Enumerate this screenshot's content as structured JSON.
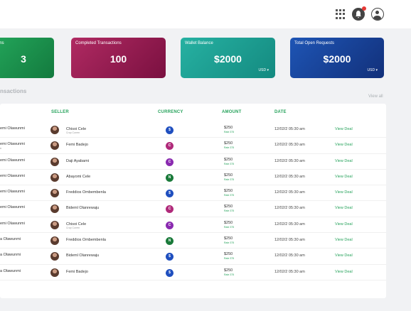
{
  "topbar": {
    "icons": [
      "grid-icon",
      "bell-icon",
      "user-icon"
    ],
    "notification_color": "#e53935"
  },
  "cards": [
    {
      "title": "ons",
      "value": "3",
      "currency": ""
    },
    {
      "title": "Completed Transactions",
      "value": "100",
      "currency": ""
    },
    {
      "title": "Wallet Balance",
      "value": "$2000",
      "currency": "USD ▾"
    },
    {
      "title": "Total Open Requests",
      "value": "$2000",
      "currency": "USD ▾"
    }
  ],
  "section": {
    "title": "nsactions",
    "view_all": "View all"
  },
  "table": {
    "headers": {
      "seller": "SELLER",
      "currency": "CURRENCY",
      "amount": "AMOUNT",
      "date": "DATE"
    },
    "rows": [
      {
        "buyer": "emi Olawunmi",
        "buyer_sub": "",
        "seller": "Chisoi Cele",
        "seller_sub": "Crop Curren",
        "currency": "$",
        "currency_color": "#1f4fbf",
        "amount": "$250",
        "amount_sub": "Rate 375",
        "date": "12/02/2 05:30 am",
        "action": "View Deal"
      },
      {
        "buyer": "emi Olawunmi",
        "buyer_sub": "n",
        "seller": "Femi Badejo",
        "seller_sub": "",
        "currency": "C",
        "currency_color": "#b02a7a",
        "amount": "$250",
        "amount_sub": "Rate 375",
        "date": "12/02/2 05:30 am",
        "action": "View Deal"
      },
      {
        "buyer": "emi Olawunmi",
        "buyer_sub": "",
        "seller": "Daji Ayabami",
        "seller_sub": "",
        "currency": "C",
        "currency_color": "#8a2ab0",
        "amount": "$250",
        "amount_sub": "Rate 375",
        "date": "12/02/2 05:30 am",
        "action": "View Deal"
      },
      {
        "buyer": "emi Olawunmi",
        "buyer_sub": "",
        "seller": "Abayomi Cele",
        "seller_sub": "",
        "currency": "N",
        "currency_color": "#1a7a3a",
        "amount": "$250",
        "amount_sub": "Rate 375",
        "date": "12/02/2 05:30 am",
        "action": "View Deal"
      },
      {
        "buyer": "emi Olawunmi",
        "buyer_sub": "",
        "seller": "Freddios Ombembenla",
        "seller_sub": "",
        "currency": "$",
        "currency_color": "#1f4fbf",
        "amount": "$250",
        "amount_sub": "Rate 375",
        "date": "12/02/2 05:30 am",
        "action": "View Deal"
      },
      {
        "buyer": "emi Olawunmi",
        "buyer_sub": "",
        "seller": "Bideml Olanrewaju",
        "seller_sub": "",
        "currency": "C",
        "currency_color": "#b02a7a",
        "amount": "$250",
        "amount_sub": "Rate 375",
        "date": "12/02/2 05:30 am",
        "action": "View Deal"
      },
      {
        "buyer": "emi Olawunmi",
        "buyer_sub": "",
        "seller": "Chisoi Cele",
        "seller_sub": "Crop Curren",
        "currency": "C",
        "currency_color": "#8a2ab0",
        "amount": "$250",
        "amount_sub": "Rate 375",
        "date": "12/02/2 05:30 am",
        "action": "View Deal"
      },
      {
        "buyer": "a Olawunmi",
        "buyer_sub": "",
        "seller": "Freddios Ombembenla",
        "seller_sub": "",
        "currency": "N",
        "currency_color": "#1a7a3a",
        "amount": "$250",
        "amount_sub": "Rate 375",
        "date": "12/02/2 05:30 am",
        "action": "View Deal"
      },
      {
        "buyer": "a Olawunmi",
        "buyer_sub": "",
        "seller": "Bideml Olanrewaju",
        "seller_sub": "",
        "currency": "$",
        "currency_color": "#1f4fbf",
        "amount": "$250",
        "amount_sub": "Rate 375",
        "date": "12/02/2 05:30 am",
        "action": "View Deal"
      },
      {
        "buyer": "a Olawunmi",
        "buyer_sub": "",
        "seller": "Femi Badejo",
        "seller_sub": "",
        "currency": "$",
        "currency_color": "#1f4fbf",
        "amount": "$250",
        "amount_sub": "Rate 375",
        "date": "12/02/2 05:30 am",
        "action": "View Deal"
      }
    ]
  }
}
